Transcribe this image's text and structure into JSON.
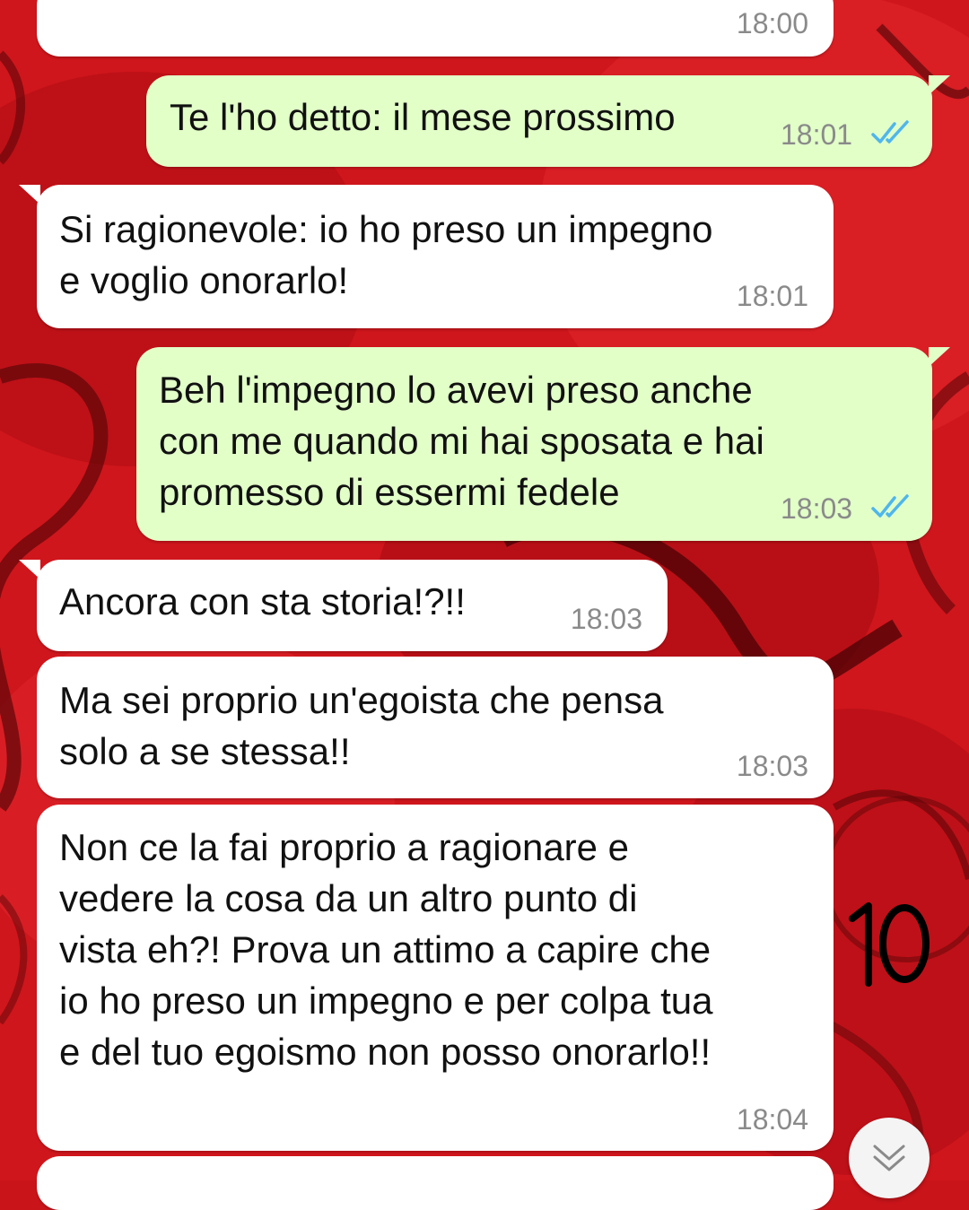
{
  "colors": {
    "incoming_bubble": "#ffffff",
    "outgoing_bubble": "#e2ffc8",
    "read_ticks": "#4fb6ec",
    "timestamp": "#8a8a8a",
    "wallpaper": "#c9141a"
  },
  "messages": [
    {
      "direction": "in",
      "text": "",
      "time": "18:00"
    },
    {
      "direction": "out",
      "text": "Te l'ho detto: il mese prossimo",
      "time": "18:01",
      "status": "read"
    },
    {
      "direction": "in",
      "text": "Si ragionevole: io ho preso un impegno\ne voglio onorarlo!",
      "time": "18:01"
    },
    {
      "direction": "out",
      "text": "Beh l'impegno lo avevi preso anche\ncon me quando mi hai sposata e hai\npromesso di essermi fedele",
      "time": "18:03",
      "status": "read"
    },
    {
      "direction": "in",
      "text": "Ancora con sta storia!?!!",
      "time": "18:03"
    },
    {
      "direction": "in",
      "text": "Ma sei proprio un'egoista che pensa\nsolo a se stessa!!",
      "time": "18:03"
    },
    {
      "direction": "in",
      "text": "Non ce la fai proprio a ragionare e\nvedere la cosa da un altro punto di\nvista eh?! Prova un attimo a capire che\nio ho preso un impegno e per colpa tua\ne del tuo egoismo non posso onorarlo!!",
      "time": "18:04"
    }
  ],
  "annotation": "10",
  "scroll_button_icon": "double-chevron-down-icon"
}
